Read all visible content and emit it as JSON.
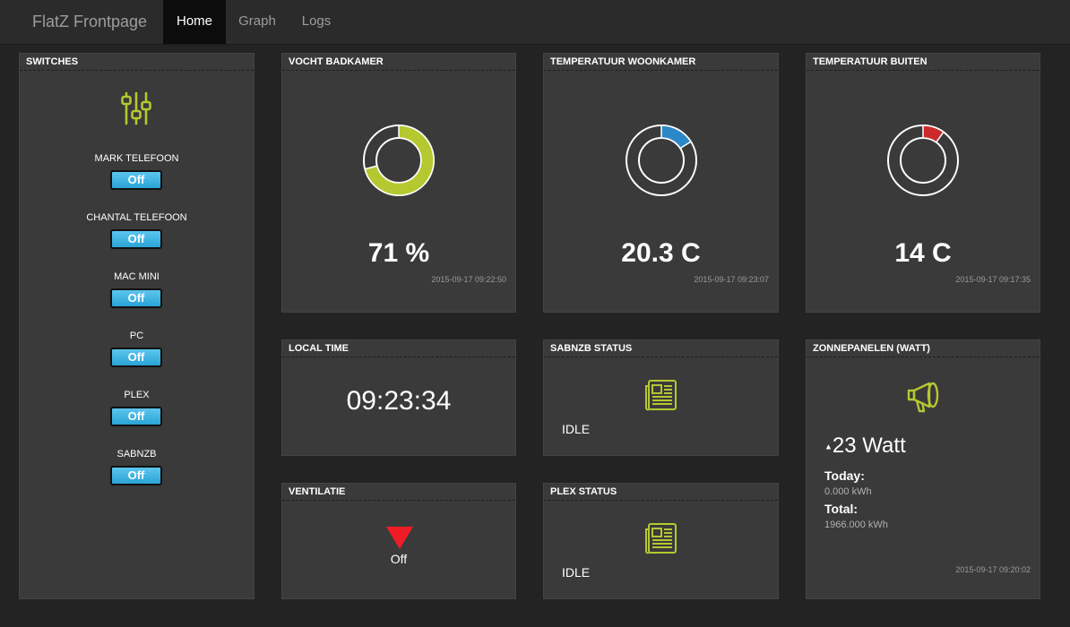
{
  "nav": {
    "brand": "FlatZ Frontpage",
    "items": [
      "Home",
      "Graph",
      "Logs"
    ]
  },
  "switches": {
    "title": "SWITCHES",
    "icon": "sliders-icon",
    "items": [
      {
        "label": "MARK TELEFOON",
        "state": "Off"
      },
      {
        "label": "CHANTAL TELEFOON",
        "state": "Off"
      },
      {
        "label": "MAC MINI",
        "state": "Off"
      },
      {
        "label": "PC",
        "state": "Off"
      },
      {
        "label": "PLEX",
        "state": "Off"
      },
      {
        "label": "SABNZB",
        "state": "Off"
      }
    ]
  },
  "vocht": {
    "title": "VOCHT BADKAMER",
    "value": "71 %",
    "fraction": 0.71,
    "color": "#b5c830",
    "timestamp": "2015-09-17 09:22:50"
  },
  "temp_woon": {
    "title": "TEMPERATUUR WOONKAMER",
    "value": "20.3 C",
    "fraction": 0.16,
    "color": "#2b87c6",
    "timestamp": "2015-09-17 09:23:07"
  },
  "temp_buiten": {
    "title": "TEMPERATUUR BUITEN",
    "value": "14 C",
    "fraction": 0.1,
    "color": "#cc2a2a",
    "timestamp": "2015-09-17 09:17:35"
  },
  "local_time": {
    "title": "LOCAL TIME",
    "value": "09:23:34"
  },
  "sabnzb": {
    "title": "SABNZB STATUS",
    "icon": "newspaper-icon",
    "status": "IDLE"
  },
  "plex": {
    "title": "PLEX STATUS",
    "icon": "newspaper-icon",
    "status": "IDLE"
  },
  "ventilatie": {
    "title": "VENTILATIE",
    "icon": "triangle-down-icon",
    "state": "Off"
  },
  "zonnepanelen": {
    "title": "ZONNEPANELEN (WATT)",
    "icon": "megaphone-icon",
    "power": "23 Watt",
    "today_label": "Today:",
    "today_value": "0.000 kWh",
    "total_label": "Total:",
    "total_value": "1966.000 kWh",
    "timestamp": "2015-09-17 09:20:02"
  }
}
